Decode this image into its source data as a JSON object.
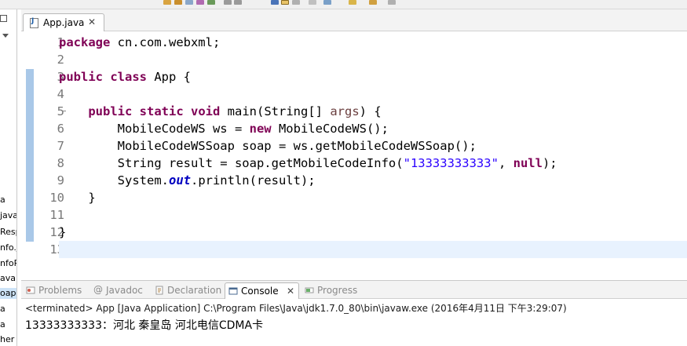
{
  "editor": {
    "tab_label": "App.java",
    "line_numbers": [
      "1",
      "2",
      "3",
      "4",
      "5",
      "6",
      "7",
      "8",
      "9",
      "10",
      "11",
      "12",
      "13"
    ],
    "code": {
      "l1_kw": "package",
      "l1_rest": " cn.com.webxml;",
      "l3_kw1": "public",
      "l3_kw2": "class",
      "l3_rest": " App {",
      "l5_indent": "    ",
      "l5_kw1": "public",
      "l5_kw2": "static",
      "l5_kw3": "void",
      "l5_mid": " main(String[] ",
      "l5_param": "args",
      "l5_end": ") {",
      "l6_a": "        MobileCodeWS ws = ",
      "l6_kw": "new",
      "l6_b": " MobileCodeWS();",
      "l7": "        MobileCodeWSSoap soap = ws.getMobileCodeWSSoap();",
      "l8_a": "        String result = soap.getMobileCodeInfo(",
      "l8_str": "\"13333333333\"",
      "l8_b": ", ",
      "l8_kw": "null",
      "l8_c": ");",
      "l9_a": "        System.",
      "l9_field": "out",
      "l9_b": ".println(result);",
      "l10": "    }",
      "l12": "}"
    }
  },
  "left_panel": {
    "items": [
      "a",
      "java",
      "Resp",
      "nfo.j",
      "nfoR",
      "ava",
      "oap",
      "a",
      "a",
      "her"
    ]
  },
  "bottom_tabs": [
    {
      "label": "Problems"
    },
    {
      "label": "Javadoc"
    },
    {
      "label": "Declaration"
    },
    {
      "label": "Console",
      "active": true
    },
    {
      "label": "Progress"
    }
  ],
  "console": {
    "status": "<terminated> App [Java Application] C:\\Program Files\\Java\\jdk1.7.0_80\\bin\\javaw.exe (2016年4月11日 下午3:29:07)",
    "output": "13333333333：河北 秦皇岛 河北电信CDMA卡"
  },
  "colors": {
    "keyword": "#7f0055",
    "string": "#2a00ff",
    "static_field": "#0000c0",
    "current_line": "#e8f2fe"
  }
}
